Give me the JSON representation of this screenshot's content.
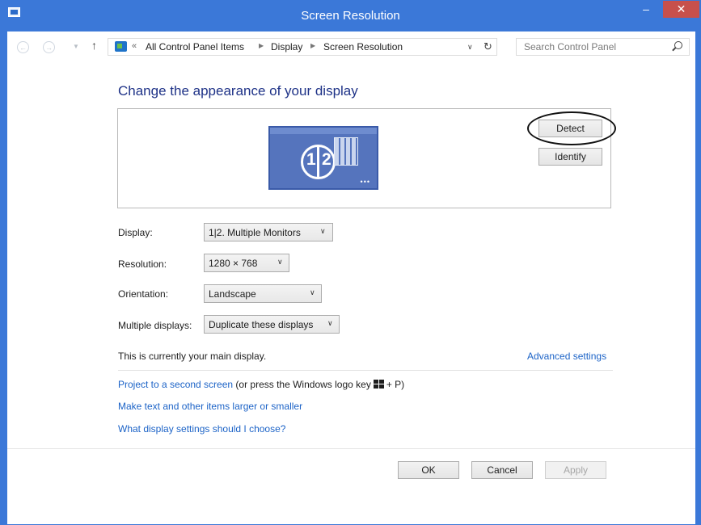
{
  "window": {
    "title": "Screen Resolution"
  },
  "nav": {
    "back_glyph": "←",
    "forward_glyph": "→",
    "up_glyph": "↑",
    "crumb_prefix": "«",
    "crumbs": [
      "All Control Panel Items",
      "Display",
      "Screen Resolution"
    ],
    "search_placeholder": "Search Control Panel"
  },
  "heading": "Change the appearance of your display",
  "preview": {
    "monitor_left_num": "1",
    "monitor_right_num": "2",
    "dots": "•••"
  },
  "buttons": {
    "detect": "Detect",
    "identify": "Identify",
    "ok": "OK",
    "cancel": "Cancel",
    "apply": "Apply"
  },
  "fields": {
    "display": {
      "label": "Display:",
      "value": "1|2. Multiple Monitors"
    },
    "resolution": {
      "label": "Resolution:",
      "value": "1280 × 768"
    },
    "orientation": {
      "label": "Orientation:",
      "value": "Landscape"
    },
    "multiple": {
      "label": "Multiple displays:",
      "value": "Duplicate these displays"
    }
  },
  "main_display_text": "This is currently your main display.",
  "advanced_link": "Advanced settings",
  "links": {
    "project": "Project to a second screen",
    "project_suffix_a": " (or press the Windows logo key",
    "project_suffix_b": "+ P)",
    "larger": "Make text and other items larger or smaller",
    "which": "What display settings should I choose?"
  },
  "colors": {
    "titlebar": "#3b78d8",
    "close": "#c7504b",
    "heading": "#1e3287",
    "link": "#1c63c7",
    "monitor": "#5574bd"
  },
  "icons": [
    "app-icon",
    "back-arrow-icon",
    "forward-arrow-icon",
    "up-arrow-icon",
    "control-panel-icon",
    "refresh-icon",
    "search-icon",
    "windows-logo-icon",
    "monitor-icon"
  ]
}
